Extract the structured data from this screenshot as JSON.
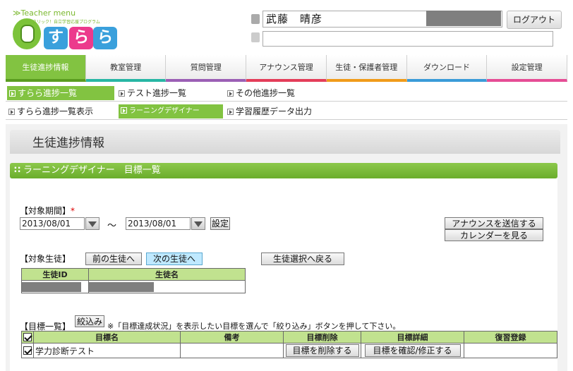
{
  "header": {
    "teacher_menu": "≫Teacher menu",
    "logo_tagline": "クリック！自立学習応援プログラム",
    "logo_chars": [
      "す",
      "ら",
      "ら"
    ],
    "user_name": "武藤　晴彦",
    "logout_label": "ログアウト"
  },
  "nav": {
    "tabs": [
      {
        "label": "生徒進捗情報"
      },
      {
        "label": "教室管理"
      },
      {
        "label": "質問管理"
      },
      {
        "label": "アナウンス管理"
      },
      {
        "label": "生徒・保護者管理"
      },
      {
        "label": "ダウンロード"
      },
      {
        "label": "設定管理"
      }
    ],
    "sub1": [
      {
        "label": "すらら進捗一覧"
      },
      {
        "label": "テスト進捗一覧"
      },
      {
        "label": "その他進捗一覧"
      }
    ],
    "sub2": [
      {
        "label": "すらら進捗一覧表示"
      },
      {
        "label": "ラーニングデザイナー"
      },
      {
        "label": "学習履歴データ出力"
      }
    ]
  },
  "page": {
    "title": "生徒進捗情報",
    "section_title": "ラーニングデザイナー　目標一覧"
  },
  "period": {
    "label": "【対象期間】",
    "required_mark": "*",
    "from": "2013/08/01",
    "tilde": "～",
    "to": "2013/08/01",
    "set_label": "設定"
  },
  "actions": {
    "send_announce": "アナウンスを送信する",
    "view_calendar": "カレンダーを見る"
  },
  "student": {
    "label": "【対象生徒】",
    "prev": "前の生徒へ",
    "next": "次の生徒へ",
    "back": "生徒選択へ戻る",
    "columns": [
      "生徒ID",
      "生徒名"
    ]
  },
  "goals": {
    "label": "【目標一覧】",
    "filter": "絞込み",
    "note": "※「目標達成状況」を表示したい目標を選んで「絞り込み」ボタンを押して下さい。",
    "columns": [
      "目標名",
      "備考",
      "目標削除",
      "目標詳細",
      "復習登録"
    ],
    "rows": [
      {
        "name": "学力診断テスト",
        "remark": "",
        "delete": "目標を削除する",
        "detail": "目標を確認/修正する",
        "review": ""
      }
    ]
  }
}
